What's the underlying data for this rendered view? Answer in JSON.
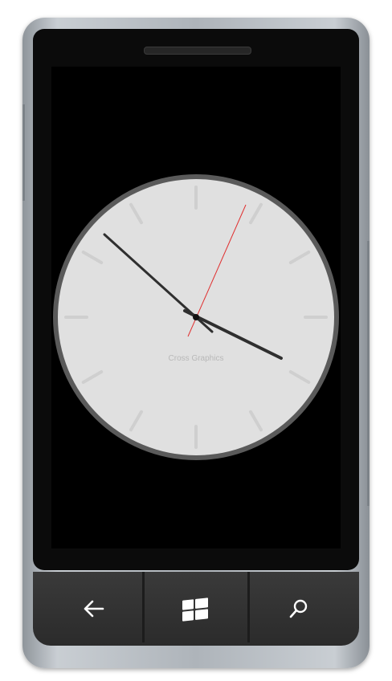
{
  "clock": {
    "brand_text": "Cross Graphics",
    "face_color": "#e0e0e0",
    "rim_color": "#5a5a5a",
    "tick_color": "#cfcfcf",
    "hand_color": "#2f2f2f",
    "second_hand_color": "#e03030"
  },
  "nav": {
    "back_icon": "back-arrow-icon",
    "start_icon": "windows-logo-icon",
    "search_icon": "search-icon"
  }
}
